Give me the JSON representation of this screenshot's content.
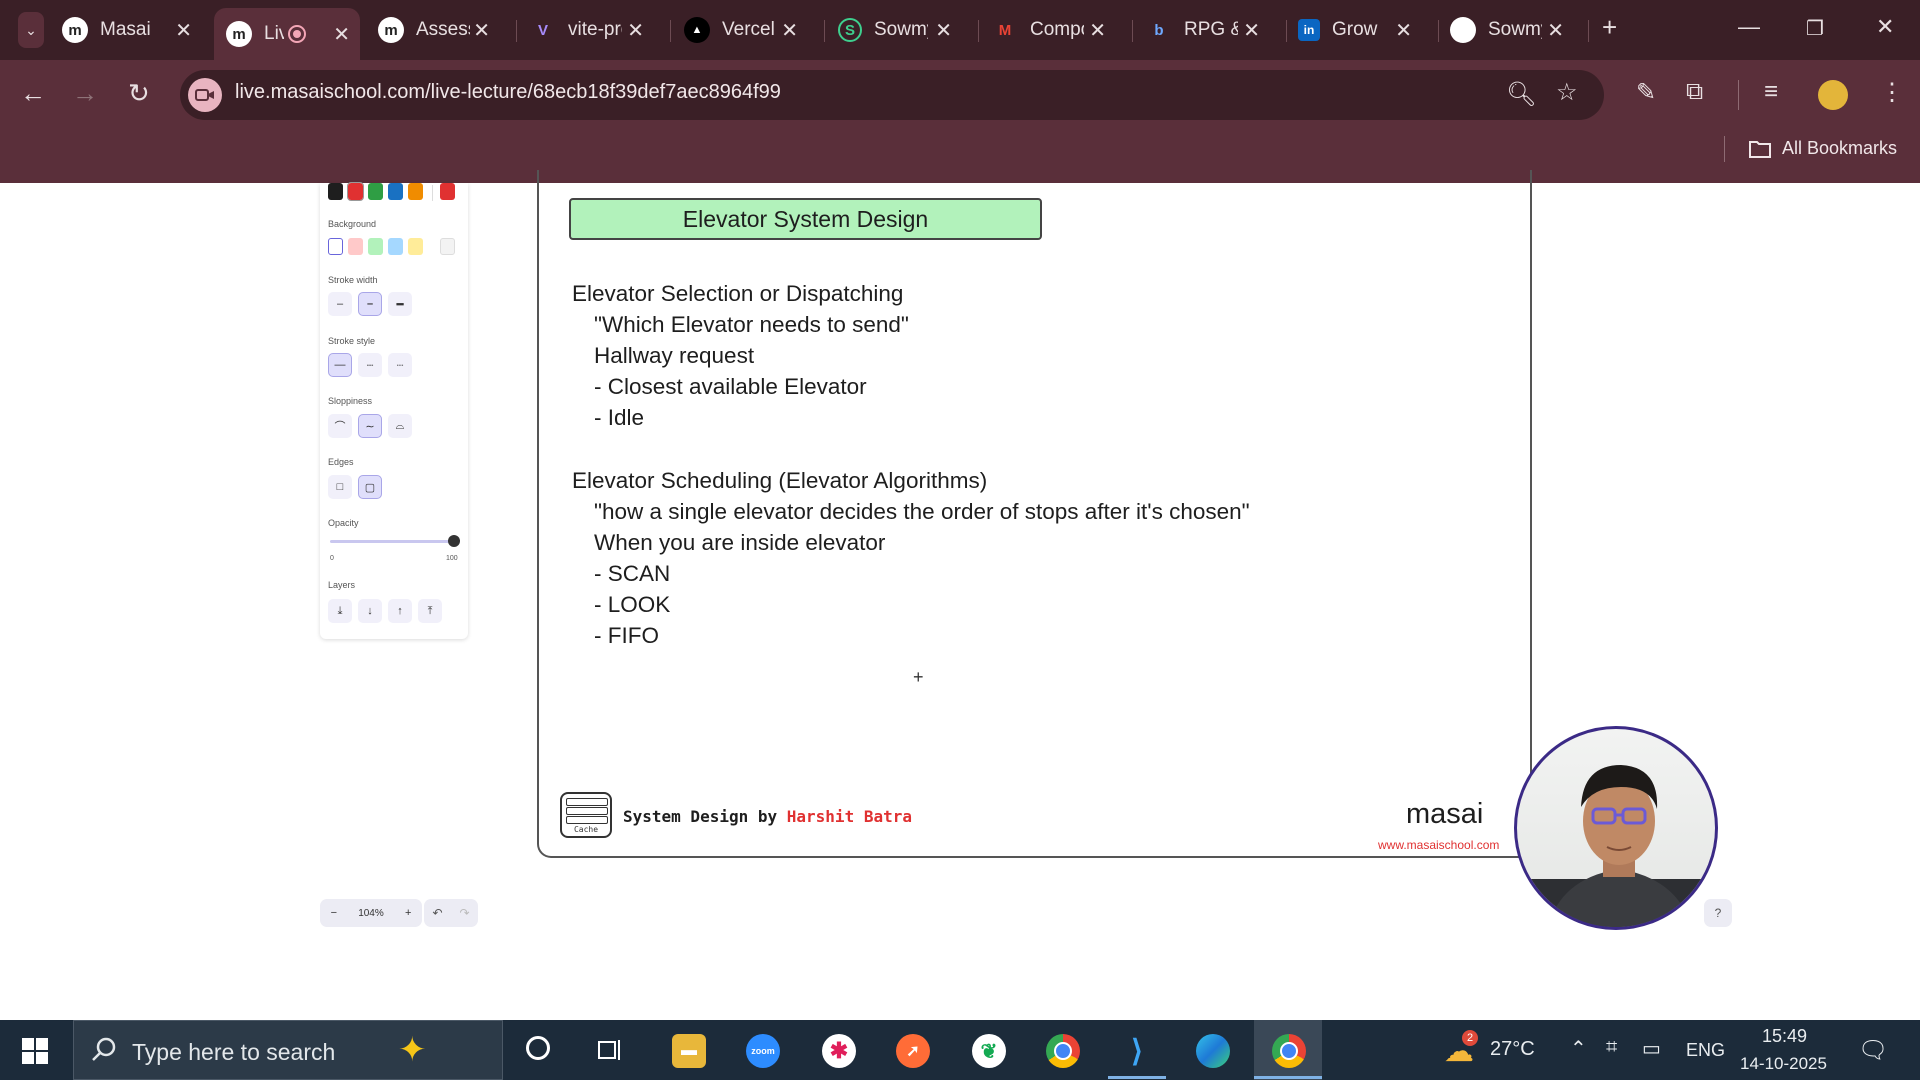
{
  "browser": {
    "tabs": [
      {
        "title": "Masai",
        "favicon": "m"
      },
      {
        "title": "Live",
        "favicon": "m",
        "active": true
      },
      {
        "title": "Assessments",
        "favicon": "m"
      },
      {
        "title": "vite-project",
        "favicon": "V"
      },
      {
        "title": "Vercel",
        "favicon": "▲"
      },
      {
        "title": "Sowmya",
        "favicon": "S"
      },
      {
        "title": "Compose",
        "favicon": "M"
      },
      {
        "title": "RPG &",
        "favicon": "b"
      },
      {
        "title": "Grow",
        "favicon": "in"
      },
      {
        "title": "Sowmya",
        "favicon": "●"
      }
    ],
    "url": "live.masaischool.com/live-lecture/68ecb18f39def7aec8964f99",
    "bookmarks_label": "All Bookmarks"
  },
  "properties_panel": {
    "background_label": "Background",
    "stroke_width_label": "Stroke width",
    "stroke_style_label": "Stroke style",
    "sloppiness_label": "Sloppiness",
    "edges_label": "Edges",
    "opacity_label": "Opacity",
    "opacity_min": "0",
    "opacity_max": "100",
    "opacity_value": 100,
    "layers_label": "Layers",
    "stroke_colors": [
      "#1e1e1e",
      "#e03131",
      "#2f9e44",
      "#1971c2",
      "#f08c00"
    ],
    "current_stroke_color": "#e03131",
    "background_colors": [
      "#ffffff",
      "#ffc9c9",
      "#b2f2bb",
      "#a5d8ff",
      "#ffec99"
    ]
  },
  "slide": {
    "title": "Elevator System Design",
    "lines": [
      "Elevator Selection or Dispatching",
      "\"Which Elevator needs to send\"",
      "Hallway request",
      "- Closest available Elevator",
      "- Idle",
      "Elevator Scheduling (Elevator Algorithms)",
      "\"how a single elevator decides the order of stops after it's chosen\"",
      "When you are inside elevator",
      "- SCAN",
      "- LOOK",
      "- FIFO"
    ],
    "footer_prefix": "System Design by ",
    "footer_author": "Harshit Batra",
    "logo_label": "Cache",
    "brand": "masai",
    "brand_url": "www.masaischool.com"
  },
  "canvas_controls": {
    "zoom_minus": "−",
    "zoom_level": "104%",
    "zoom_plus": "+"
  },
  "taskbar": {
    "search_placeholder": "Type here to search",
    "weather_badge": "2",
    "temperature": "27°C",
    "language": "ENG",
    "time": "15:49",
    "date": "14-10-2025"
  }
}
